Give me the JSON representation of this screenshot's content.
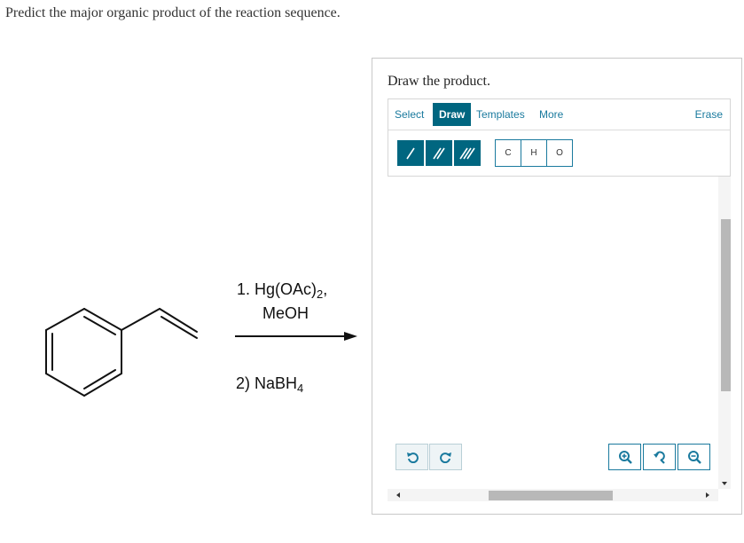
{
  "question": {
    "text": "Predict the major organic product of the reaction sequence."
  },
  "reaction": {
    "step1_line1_prefix": "1. Hg(OAc)",
    "step1_line1_sub": "2",
    "step1_line1_suffix": ",",
    "step1_line2": "MeOH",
    "step2_prefix": "2) NaBH",
    "step2_sub": "4"
  },
  "panel": {
    "title": "Draw the product.",
    "menu": {
      "select": "Select",
      "draw": "Draw",
      "templates": "Templates",
      "more": "More",
      "erase": "Erase"
    },
    "atoms": [
      "C",
      "H",
      "O"
    ],
    "bond_icons": [
      "single-bond-icon",
      "double-bond-icon",
      "triple-bond-icon"
    ],
    "accent_color": "#006680",
    "link_color": "#1a7a9e"
  }
}
